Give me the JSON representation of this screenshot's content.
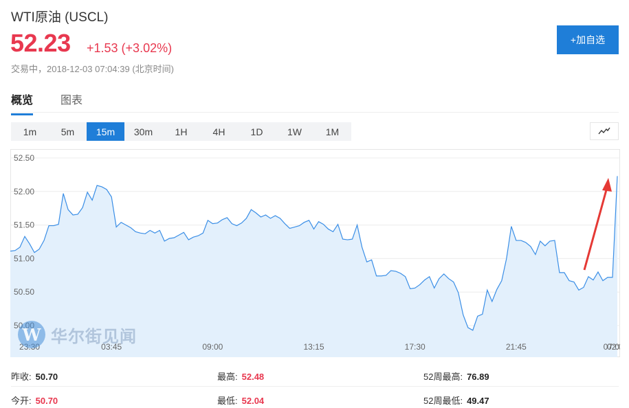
{
  "header": {
    "title": "WTI原油 (USCL)",
    "price": "52.23",
    "change": "+1.53 (+3.02%)",
    "status": "交易中，2018-12-03 07:04:39 (北京时间)",
    "add_button": "+加自选"
  },
  "tabs": [
    {
      "label": "概览",
      "active": true
    },
    {
      "label": "图表",
      "active": false
    }
  ],
  "intervals": [
    {
      "label": "1m",
      "active": false
    },
    {
      "label": "5m",
      "active": false
    },
    {
      "label": "15m",
      "active": true
    },
    {
      "label": "30m",
      "active": false
    },
    {
      "label": "1H",
      "active": false
    },
    {
      "label": "4H",
      "active": false
    },
    {
      "label": "1D",
      "active": false
    },
    {
      "label": "1W",
      "active": false
    },
    {
      "label": "1M",
      "active": false
    }
  ],
  "chart_type_icon": "line-chart-icon",
  "watermark": {
    "logo_letter": "W",
    "text": "华尔街见闻"
  },
  "colors": {
    "accent": "#1f7ed8",
    "up": "#e8384f",
    "line": "#3a8ee6",
    "fill": "#e3f0fc",
    "arrow": "#e53935"
  },
  "chart_data": {
    "type": "area",
    "ylim": [
      50.0,
      52.5
    ],
    "y_ticks": [
      50.0,
      50.5,
      51.0,
      51.5,
      52.0,
      52.5
    ],
    "y_tick_labels": [
      "50.00",
      "50.50",
      "51.00",
      "51.50",
      "52.00",
      "52.50"
    ],
    "x_tick_labels": [
      "23:30",
      "03:45",
      "09:00",
      "13:15",
      "17:30",
      "21:45",
      "02:00",
      "07:0"
    ],
    "x_tick_index": [
      4,
      21,
      42,
      63,
      84,
      105,
      126,
      147
    ],
    "values": [
      51.11,
      51.12,
      51.17,
      51.33,
      51.22,
      51.09,
      51.14,
      51.27,
      51.49,
      51.49,
      51.51,
      51.97,
      51.73,
      51.65,
      51.66,
      51.76,
      51.99,
      51.87,
      52.09,
      52.07,
      52.03,
      51.92,
      51.47,
      51.54,
      51.5,
      51.46,
      51.4,
      51.38,
      51.37,
      51.42,
      51.38,
      51.42,
      51.26,
      51.3,
      51.31,
      51.35,
      51.39,
      51.28,
      51.32,
      51.34,
      51.38,
      51.57,
      51.52,
      51.53,
      51.58,
      51.61,
      51.52,
      51.49,
      51.53,
      51.6,
      51.73,
      51.68,
      51.62,
      51.65,
      51.6,
      51.64,
      51.6,
      51.52,
      51.45,
      51.47,
      51.49,
      51.54,
      51.57,
      51.44,
      51.55,
      51.51,
      51.44,
      51.4,
      51.51,
      51.29,
      51.28,
      51.29,
      51.5,
      51.17,
      50.95,
      50.98,
      50.74,
      50.74,
      50.75,
      50.82,
      50.81,
      50.78,
      50.73,
      50.55,
      50.56,
      50.61,
      50.68,
      50.73,
      50.56,
      50.7,
      50.77,
      50.7,
      50.65,
      50.49,
      50.16,
      49.97,
      49.93,
      50.14,
      50.17,
      50.53,
      50.36,
      50.54,
      50.67,
      51.0,
      51.48,
      51.27,
      51.27,
      51.24,
      51.18,
      51.06,
      51.26,
      51.19,
      51.26,
      51.27,
      50.79,
      50.79,
      50.67,
      50.65,
      50.53,
      50.57,
      50.73,
      50.68,
      50.8,
      50.67,
      50.72,
      50.72,
      52.23
    ]
  },
  "stats": [
    [
      {
        "label": "昨收:",
        "value": "50.70",
        "tone": "dark"
      },
      {
        "label": "最高:",
        "value": "52.48",
        "tone": "red"
      },
      {
        "label": "52周最高:",
        "value": "76.89",
        "tone": "dark"
      }
    ],
    [
      {
        "label": "今开:",
        "value": "50.70",
        "tone": "red"
      },
      {
        "label": "最低:",
        "value": "52.04",
        "tone": "red"
      },
      {
        "label": "52周最低:",
        "value": "49.47",
        "tone": "dark"
      }
    ]
  ]
}
